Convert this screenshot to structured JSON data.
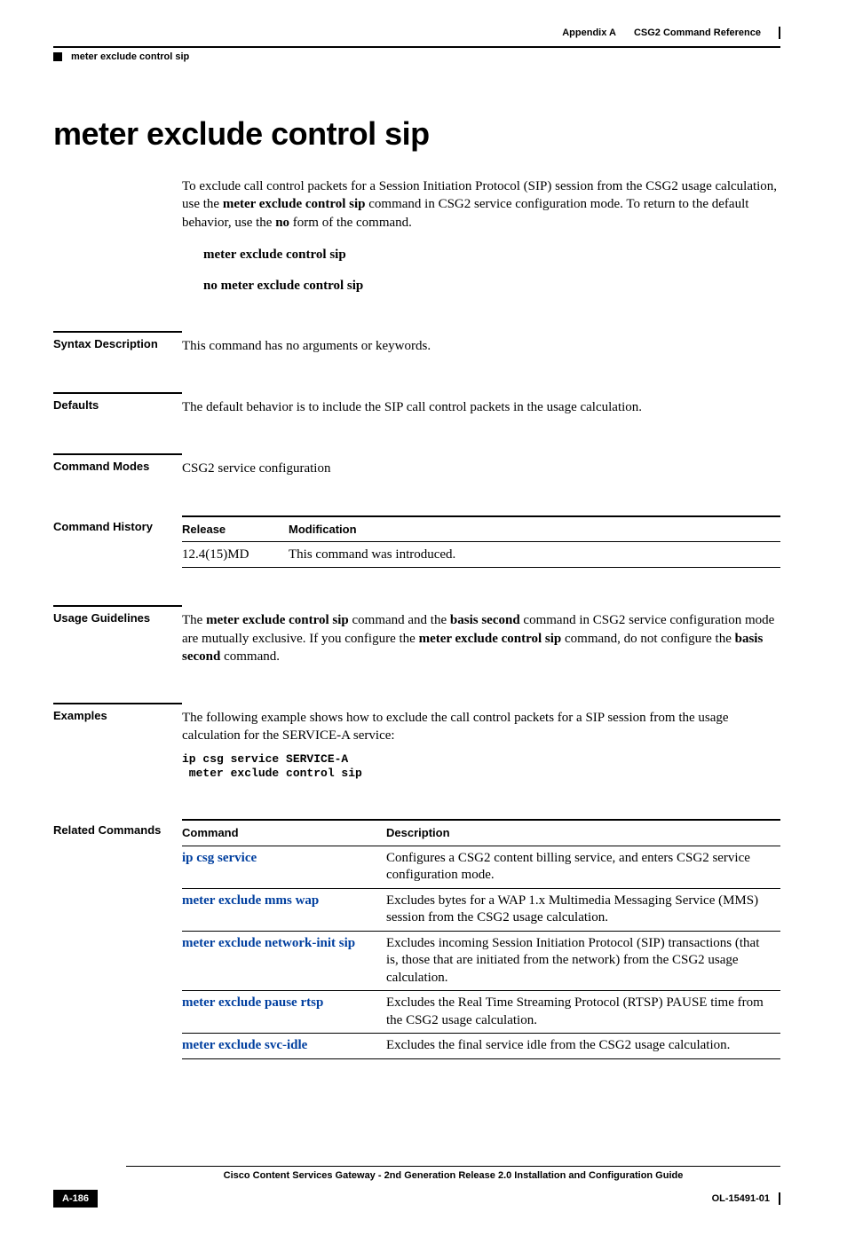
{
  "header": {
    "left_text": "meter exclude control sip",
    "right_prefix": "Appendix A",
    "right_title": "CSG2 Command Reference"
  },
  "title": "meter exclude control sip",
  "intro": {
    "p1a": "To exclude call control packets for a Session Initiation Protocol (SIP) session from the CSG2 usage calculation, use the ",
    "p1b_bold": "meter exclude control sip",
    "p1c": " command in CSG2 service configuration mode. To return to the default behavior, use the ",
    "p1d_bold": "no",
    "p1e": " form of the command."
  },
  "syntax_lines": {
    "line1": "meter exclude control sip",
    "line2": "no meter exclude control sip"
  },
  "sections": {
    "syntax_label": "Syntax Description",
    "syntax_text": "This command has no arguments or keywords.",
    "defaults_label": "Defaults",
    "defaults_text": "The default behavior is to include the SIP call control packets in the usage calculation.",
    "modes_label": "Command Modes",
    "modes_text": "CSG2 service configuration",
    "history_label": "Command History",
    "history_head_release": "Release",
    "history_head_mod": "Modification",
    "history_row_release": "12.4(15)MD",
    "history_row_mod": "This command was introduced.",
    "usage_label": "Usage Guidelines",
    "usage_a": "The ",
    "usage_b_bold": "meter exclude control sip",
    "usage_c": " command and the ",
    "usage_d_bold": "basis second",
    "usage_e": " command in CSG2 service configuration mode are mutually exclusive. If you configure the ",
    "usage_f_bold": "meter exclude control sip",
    "usage_g": " command, do not configure the ",
    "usage_h_bold": "basis second",
    "usage_i": " command.",
    "examples_label": "Examples",
    "examples_text": "The following example shows how to exclude the call control packets for a SIP session from the usage calculation for the SERVICE-A service:",
    "examples_code": "ip csg service SERVICE-A\n meter exclude control sip",
    "related_label": "Related Commands",
    "related_head_cmd": "Command",
    "related_head_desc": "Description",
    "related_rows": [
      {
        "cmd": "ip csg service",
        "desc": "Configures a CSG2 content billing service, and enters CSG2 service configuration mode."
      },
      {
        "cmd": "meter exclude mms wap",
        "desc": "Excludes bytes for a WAP 1.x Multimedia Messaging Service (MMS) session from the CSG2 usage calculation."
      },
      {
        "cmd": "meter exclude network-init sip",
        "desc": "Excludes incoming Session Initiation Protocol (SIP) transactions (that is, those that are initiated from the network) from the CSG2 usage calculation."
      },
      {
        "cmd": "meter exclude pause rtsp",
        "desc": "Excludes the Real Time Streaming Protocol (RTSP) PAUSE time from the CSG2 usage calculation."
      },
      {
        "cmd": "meter exclude svc-idle",
        "desc": "Excludes the final service idle from the CSG2 usage calculation."
      }
    ]
  },
  "footer": {
    "book_title": "Cisco Content Services Gateway - 2nd Generation Release 2.0 Installation and Configuration Guide",
    "page_num": "A-186",
    "doc_id": "OL-15491-01"
  }
}
